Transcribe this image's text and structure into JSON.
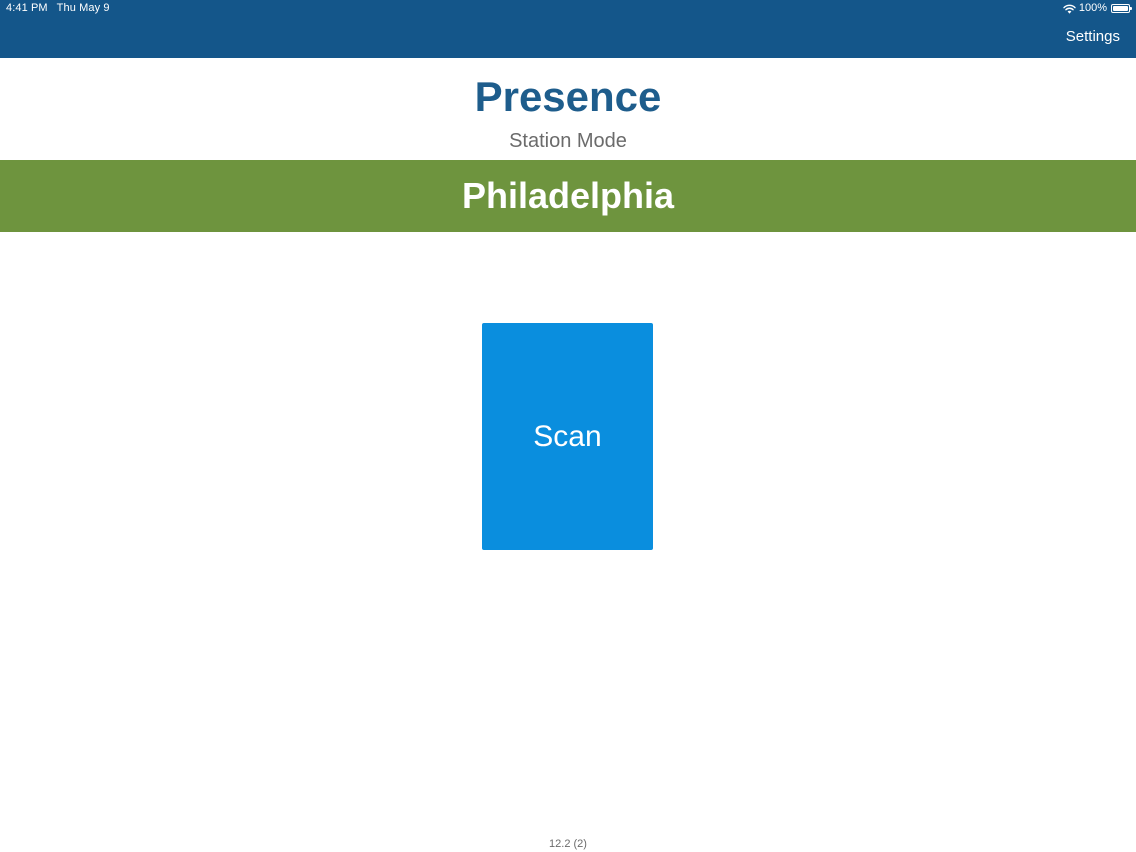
{
  "status_bar": {
    "time": "4:41 PM",
    "date": "Thu May 9",
    "battery": "100%",
    "battery_level": 1.0,
    "icons": [
      "wifi-icon",
      "battery-icon"
    ]
  },
  "nav": {
    "settings_label": "Settings"
  },
  "header": {
    "title": "Presence",
    "subtitle": "Station Mode"
  },
  "location": {
    "name": "Philadelphia"
  },
  "scan": {
    "label": "Scan"
  },
  "footer": {
    "version": "12.2 (2)"
  },
  "colors": {
    "nav_bar": "#14568a",
    "title": "#1e5d8c",
    "location_banner": "#6e943e",
    "scan_button": "#0a8ede",
    "muted_text": "#6b6b6b"
  }
}
